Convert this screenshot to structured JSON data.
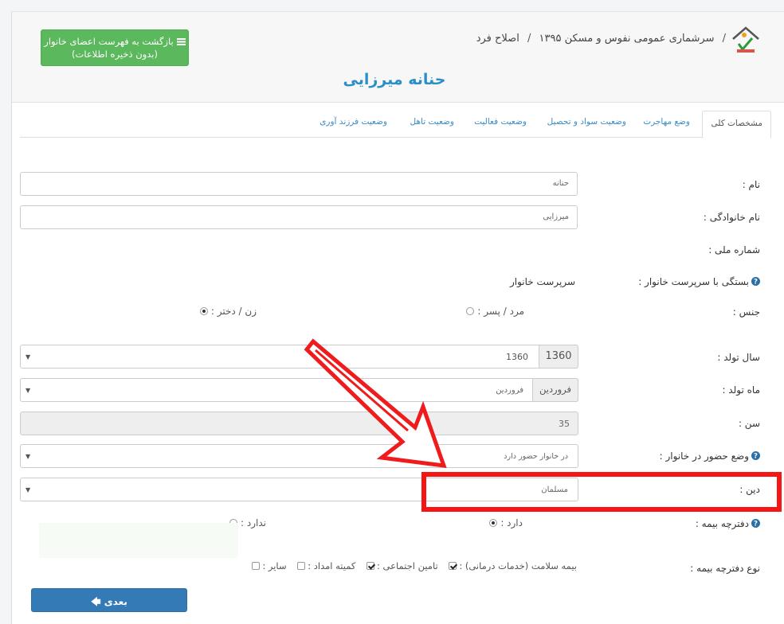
{
  "header": {
    "back_button_line1": "بازگشت به فهرست اعضای خانوار",
    "back_button_line2": "(بدون ذخیره اطلاعات)",
    "breadcrumb": [
      "سرشماری عمومی نفوس و مسکن ۱۳۹۵",
      "اصلاح فرد"
    ],
    "breadcrumb_separator": "/",
    "page_title": "حنانه  میرزایی"
  },
  "tabs": [
    {
      "label": "مشخصات کلی",
      "active": true
    },
    {
      "label": "وضع مهاجرت"
    },
    {
      "label": "وضعیت سواد و تحصیل"
    },
    {
      "label": "وضعیت فعالیت"
    },
    {
      "label": "وضعیت تاهل"
    },
    {
      "label": "وضعیت فرزند آوری"
    }
  ],
  "form": {
    "first_name": {
      "label": "نام :",
      "value": "حنانه"
    },
    "last_name": {
      "label": "نام خانوادگی :",
      "value": "میرزایی"
    },
    "national_id": {
      "label": "شماره ملی :"
    },
    "relation": {
      "label": "بستگی با سرپرست خانوار :",
      "value": "سرپرست خانوار"
    },
    "gender": {
      "label": "جنس :",
      "options": [
        "مرد / پسر :",
        "زن / دختر :"
      ],
      "selected": 1
    },
    "birth_year": {
      "label": "سال تولد :",
      "addon": "1360",
      "value": "1360"
    },
    "birth_month": {
      "label": "ماه تولد :",
      "addon": "فروردین",
      "value": "فروردین"
    },
    "age": {
      "label": "سن :",
      "value": "35"
    },
    "presence": {
      "label": "وضع حضور در خانوار :",
      "value": "در خانوار حضور دارد"
    },
    "religion": {
      "label": "دین :",
      "value": "مسلمان"
    },
    "insurance_book": {
      "label": "دفترچه بیمه :",
      "options": [
        "دارد :",
        "ندارد :"
      ],
      "selected": 0
    },
    "insurance_type": {
      "label": "نوع دفترچه بیمه :",
      "options": [
        {
          "label": "بیمه سلامت (خدمات درمانی) :",
          "checked": true
        },
        {
          "label": "تامین اجتماعی :",
          "checked": true
        },
        {
          "label": "کمیته امداد :",
          "checked": false
        },
        {
          "label": "سایر :",
          "checked": false
        }
      ]
    }
  },
  "next_button": "بعدی",
  "colors": {
    "accent_blue": "#2a8fc6",
    "green_button": "#5cb85c",
    "primary_button": "#337ab7",
    "highlight_red": "#f51515"
  }
}
